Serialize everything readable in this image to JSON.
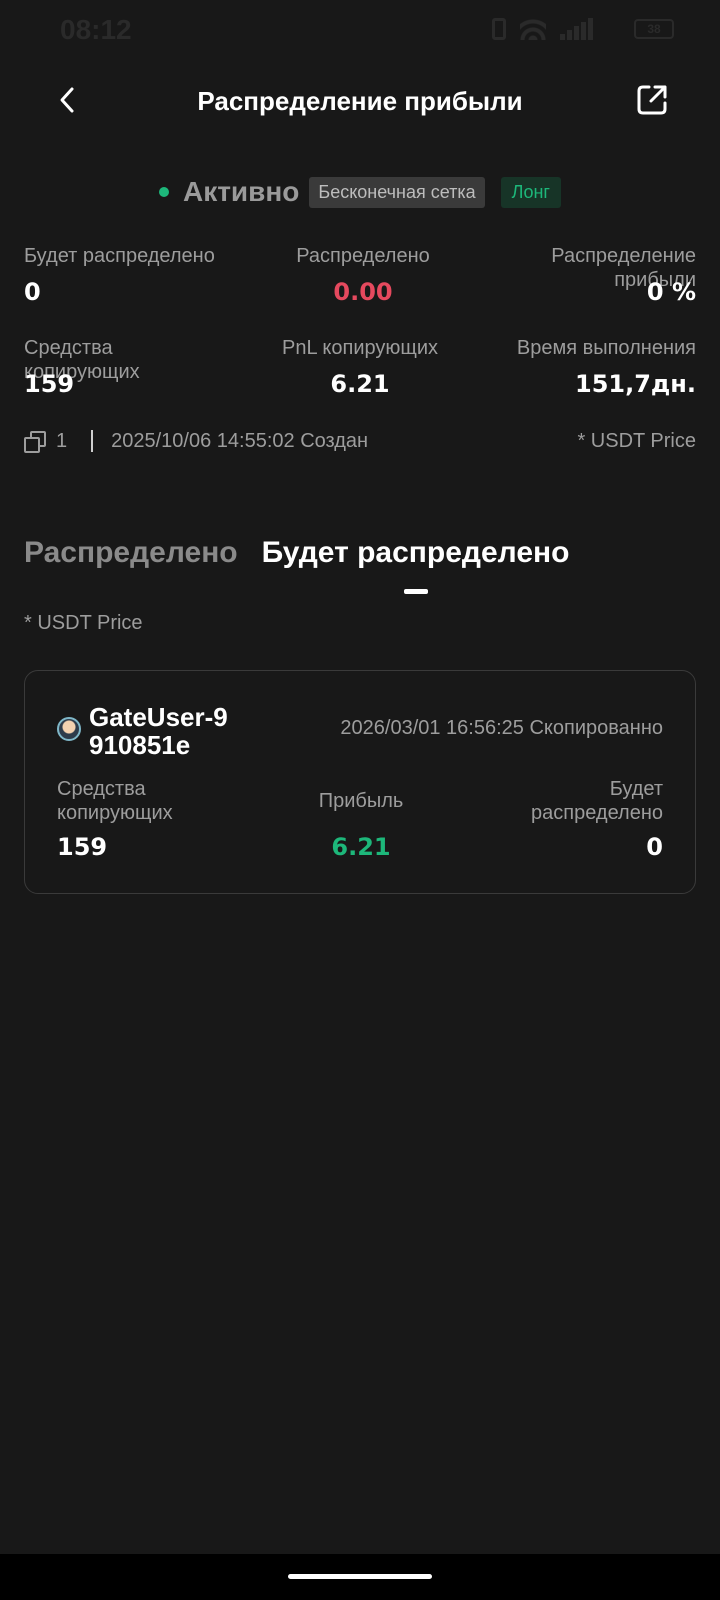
{
  "status_bar": {
    "time": "08:12",
    "battery": "38",
    "icons": [
      "vibrate-icon",
      "wifi-icon",
      "signal-icon",
      "battery-icon"
    ]
  },
  "header": {
    "title": "Распределение прибыли",
    "back_icon": "chevron-left-icon",
    "share_icon": "share-icon"
  },
  "strategy": {
    "status": "Активно",
    "type_badge": "Бесконечная сетка",
    "direction_badge": "Лонг"
  },
  "stats": {
    "to_distribute_label": "Будет распределено",
    "to_distribute_value": "0",
    "distributed_label": "Распределено",
    "distributed_value": "0.00",
    "profit_share_label": "Распределение прибыли",
    "profit_share_value": "0 %",
    "copier_funds_label": "Средства копирующих",
    "copier_funds_value": "159",
    "copier_pnl_label": "PnL копирующих",
    "copier_pnl_value": "6.21",
    "runtime_label": "Время выполнения",
    "runtime_value": "151,7дн."
  },
  "meta": {
    "copies": "1",
    "created": "2025/10/06 14:55:02 Создан",
    "price_note": "* USDT Price"
  },
  "tabs": [
    {
      "label": "Распределено",
      "active": false
    },
    {
      "label": "Будет распределено",
      "active": true
    }
  ],
  "tab_note": "* USDT Price",
  "card": {
    "username": "GateUser-9910851e",
    "date": "2026/03/01 16:56:25 Скопированно",
    "funds_label": "Средства копирующих",
    "funds_value": "159",
    "profit_label": "Прибыль",
    "profit_value": "6.21",
    "to_distribute_label": "Будет распределено",
    "to_distribute_value": "0"
  },
  "colors": {
    "background": "#181818",
    "accent_green": "#1db77a",
    "accent_red": "#e5495e"
  }
}
